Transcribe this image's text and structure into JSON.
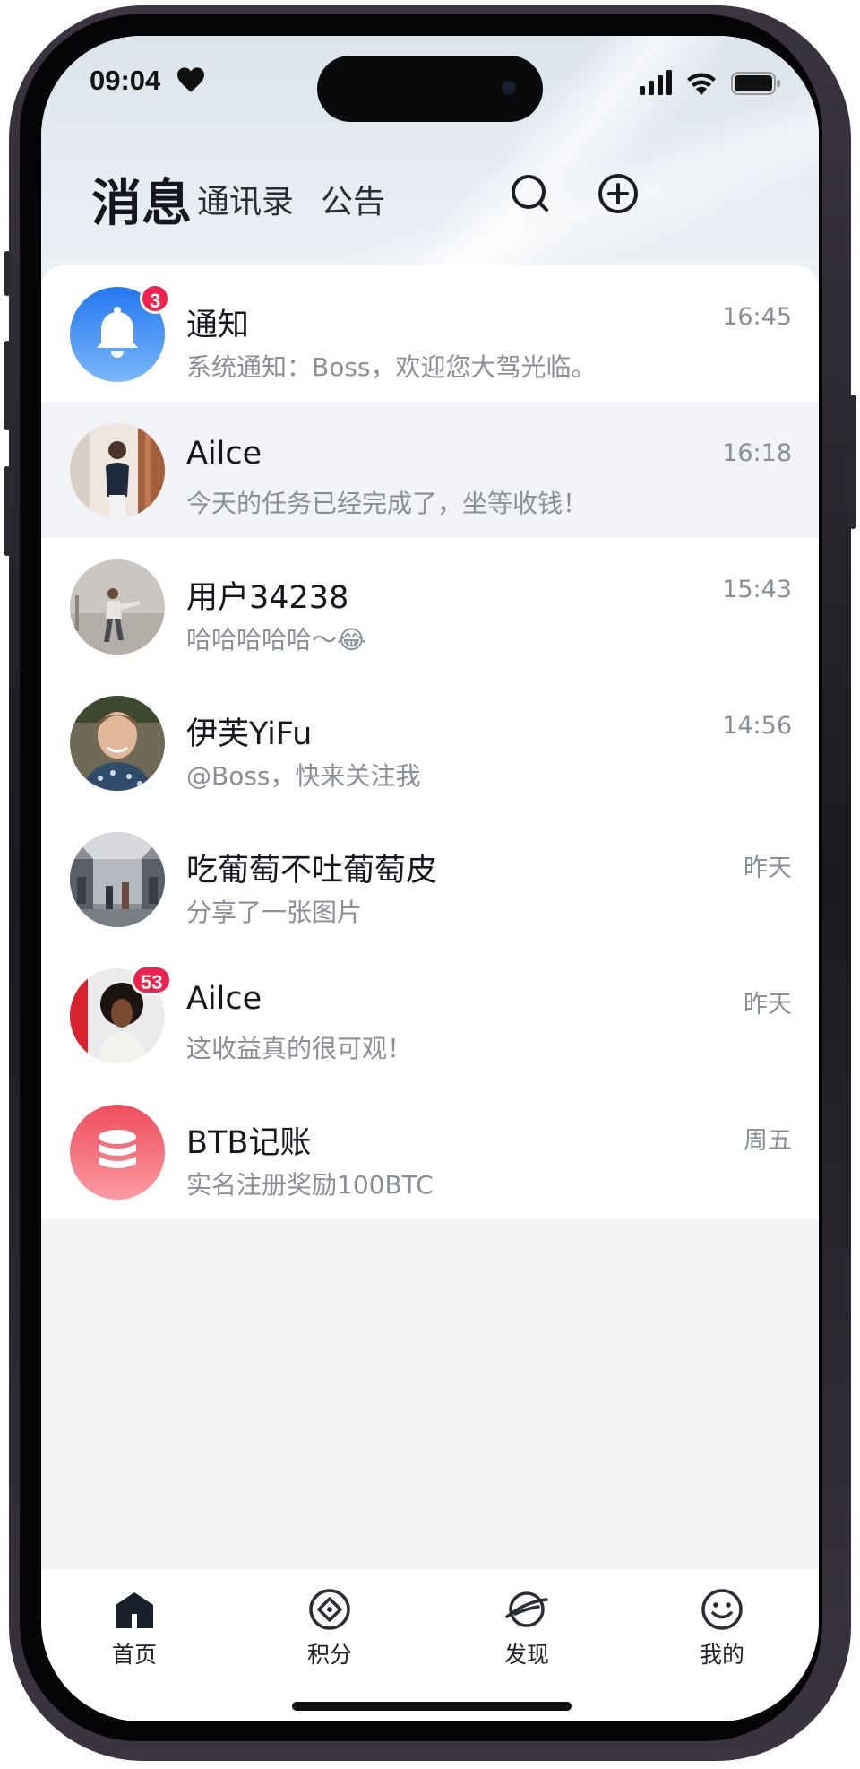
{
  "status_bar": {
    "time": "09:04"
  },
  "header": {
    "title": "消息",
    "tabs": [
      "通讯录",
      "公告"
    ]
  },
  "conversations": [
    {
      "name": "通知",
      "preview": "系统通知：Boss，欢迎您大驾光临。",
      "time": "16:45",
      "badge": "3",
      "avatar": "bell-icon"
    },
    {
      "name": "Ailce",
      "preview": "今天的任务已经完成了，坐等收钱！",
      "time": "16:18",
      "badge": "",
      "avatar": "photo"
    },
    {
      "name": "用户34238",
      "preview": "哈哈哈哈哈～😂",
      "time": "15:43",
      "badge": "",
      "avatar": "photo"
    },
    {
      "name": "伊芙YiFu",
      "preview": "@Boss，快来关注我",
      "time": "14:56",
      "badge": "",
      "avatar": "photo"
    },
    {
      "name": "吃葡萄不吐葡萄皮",
      "preview": "分享了一张图片",
      "time": "昨天",
      "badge": "",
      "avatar": "photo"
    },
    {
      "name": "Ailce",
      "preview": "这收益真的很可观！",
      "time": "昨天",
      "badge": "53",
      "avatar": "photo"
    },
    {
      "name": "BTB记账",
      "preview": "实名注册奖励100BTC",
      "time": "周五",
      "badge": "",
      "avatar": "database-icon"
    }
  ],
  "tabbar": {
    "items": [
      {
        "label": "首页",
        "icon": "home-icon"
      },
      {
        "label": "积分",
        "icon": "points-icon"
      },
      {
        "label": "发现",
        "icon": "planet-icon"
      },
      {
        "label": "我的",
        "icon": "smile-icon"
      }
    ]
  },
  "colors": {
    "badge": "#f0214c",
    "notify_blue": "#2f86f6",
    "btb_red": "#f2636f"
  }
}
